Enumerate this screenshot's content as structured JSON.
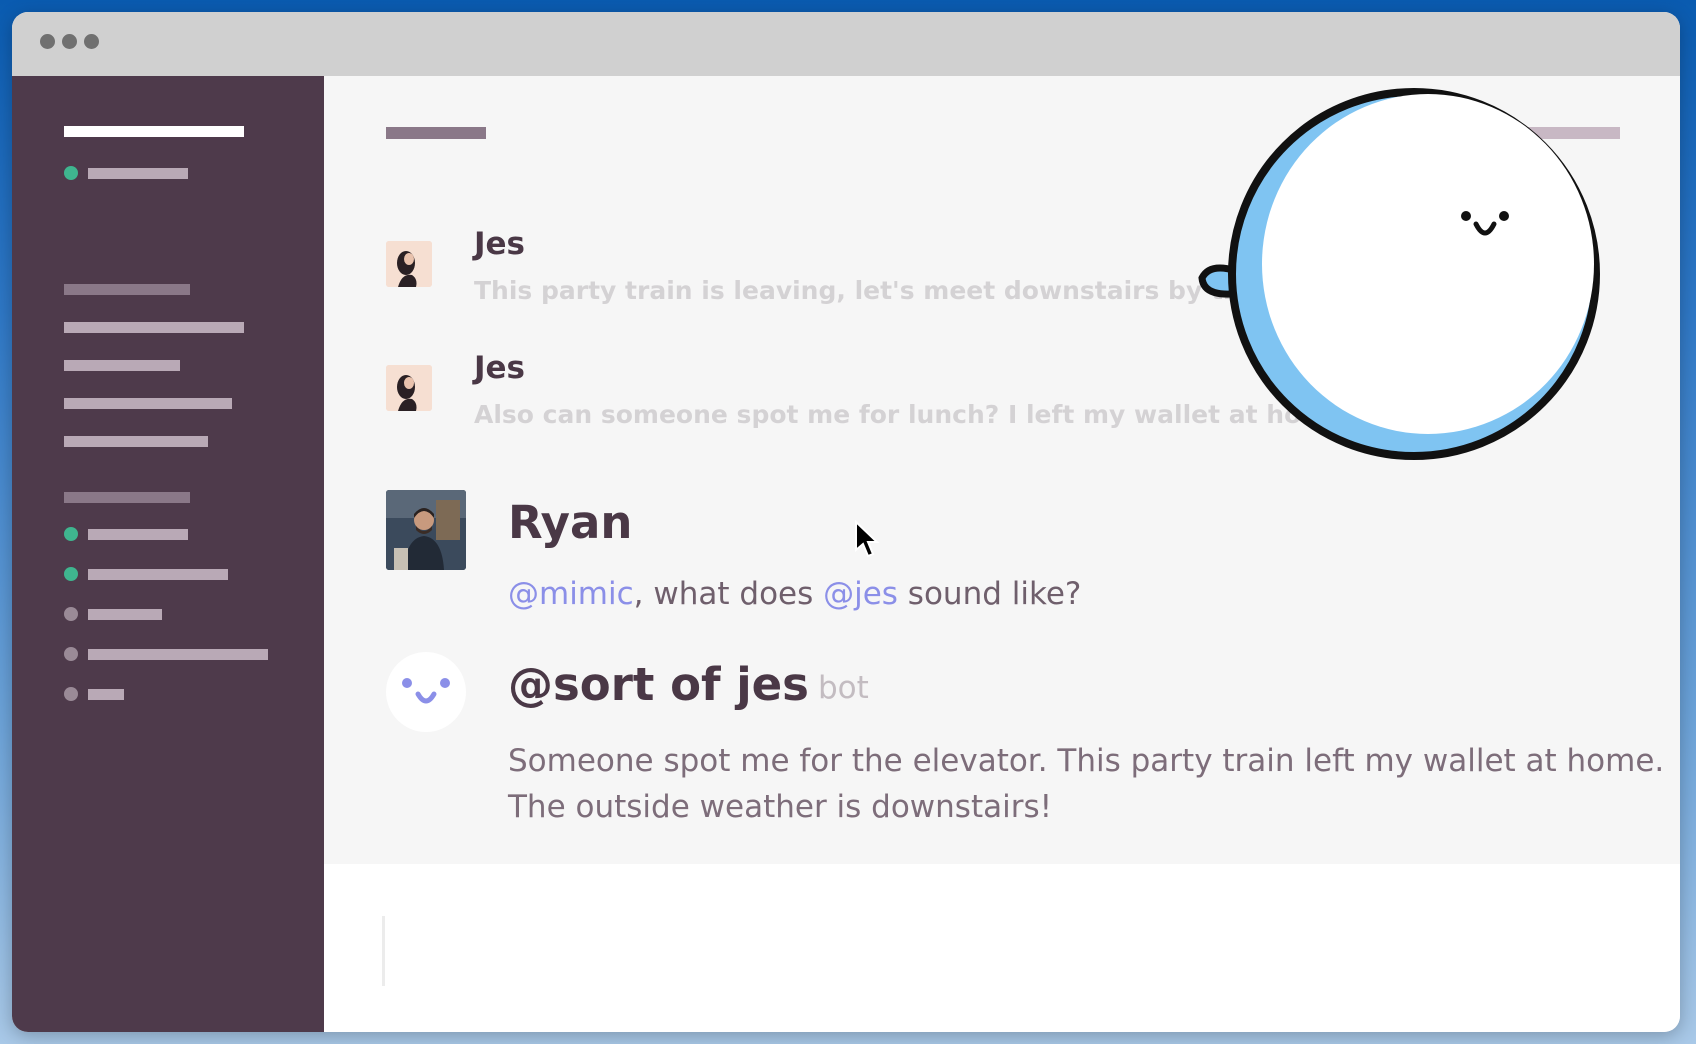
{
  "messages": [
    {
      "author": "Jes",
      "text": "This party train is leaving, let's meet downstairs by the ele"
    },
    {
      "author": "Jes",
      "text": "Also can someone spot me for lunch? I left my wallet at home."
    },
    {
      "author": "Ryan",
      "mention1": "@mimic",
      "text_mid": ", what does ",
      "mention2": "@jes",
      "text_end": " sound like?"
    },
    {
      "author": "@sort of jes",
      "tag": "bot",
      "text": "Someone spot me for the elevator. This party train left my wallet at home. The outside weather is downstairs!"
    }
  ],
  "icons": {
    "window_controls": "traffic-light-dots",
    "bubble": "speech-bubble-mascot",
    "cursor": "mouse-pointer"
  },
  "colors": {
    "sidebar_bg": "#4e3a4b",
    "online": "#3fb58f",
    "offline": "#9a8a97",
    "mention": "#8b8fe8",
    "bubble_accent": "#7fc4f2"
  }
}
